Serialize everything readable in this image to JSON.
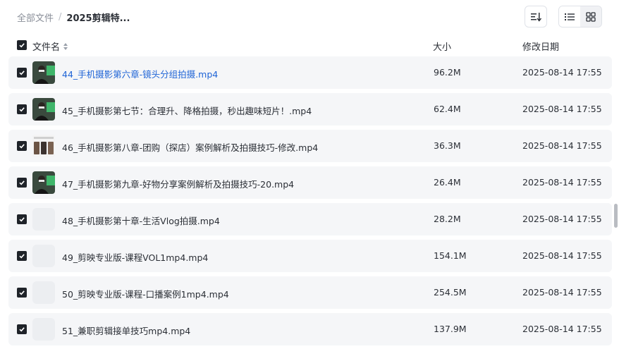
{
  "breadcrumb": {
    "root": "全部文件",
    "separator": "/",
    "current": "2025剪辑特..."
  },
  "toolbar": {
    "sort_icon": "sort-icon",
    "list_icon": "list-view-icon",
    "grid_icon": "grid-view-icon"
  },
  "table": {
    "columns": {
      "name": "文件名",
      "size": "大小",
      "modified": "修改日期"
    },
    "rows": [
      {
        "name": "44_手机摄影第六章-镜头分组拍摄.mp4",
        "size": "96.2M",
        "date": "2025-08-14 17:55",
        "thumbnail": "video-person",
        "highlighted": true
      },
      {
        "name": "45_手机摄影第七节：合理升、降格拍摄，秒出趣味短片！.mp4",
        "size": "62.4M",
        "date": "2025-08-14 17:55",
        "thumbnail": "video-person",
        "highlighted": false
      },
      {
        "name": "46_手机摄影第八章-团购（探店）案例解析及拍摄技巧-修改.mp4",
        "size": "36.3M",
        "date": "2025-08-14 17:55",
        "thumbnail": "video-phones",
        "highlighted": false
      },
      {
        "name": "47_手机摄影第九章-好物分享案例解析及拍摄技巧-20.mp4",
        "size": "26.4M",
        "date": "2025-08-14 17:55",
        "thumbnail": "video-person",
        "highlighted": false
      },
      {
        "name": "48_手机摄影第十章-生活Vlog拍摄.mp4",
        "size": "28.2M",
        "date": "2025-08-14 17:55",
        "thumbnail": "empty",
        "highlighted": false
      },
      {
        "name": "49_剪映专业版-课程VOL1mp4.mp4",
        "size": "154.1M",
        "date": "2025-08-14 17:55",
        "thumbnail": "empty",
        "highlighted": false
      },
      {
        "name": "50_剪映专业版-课程-口播案例1mp4.mp4",
        "size": "254.5M",
        "date": "2025-08-14 17:55",
        "thumbnail": "empty",
        "highlighted": false
      },
      {
        "name": "51_兼职剪辑接单技巧mp4.mp4",
        "size": "137.9M",
        "date": "2025-08-14 17:55",
        "thumbnail": "empty",
        "highlighted": false
      }
    ]
  },
  "colors": {
    "row_bg": "#f5f6f8",
    "link_blue": "#1f64d6",
    "checkbox": "#1f2329"
  }
}
